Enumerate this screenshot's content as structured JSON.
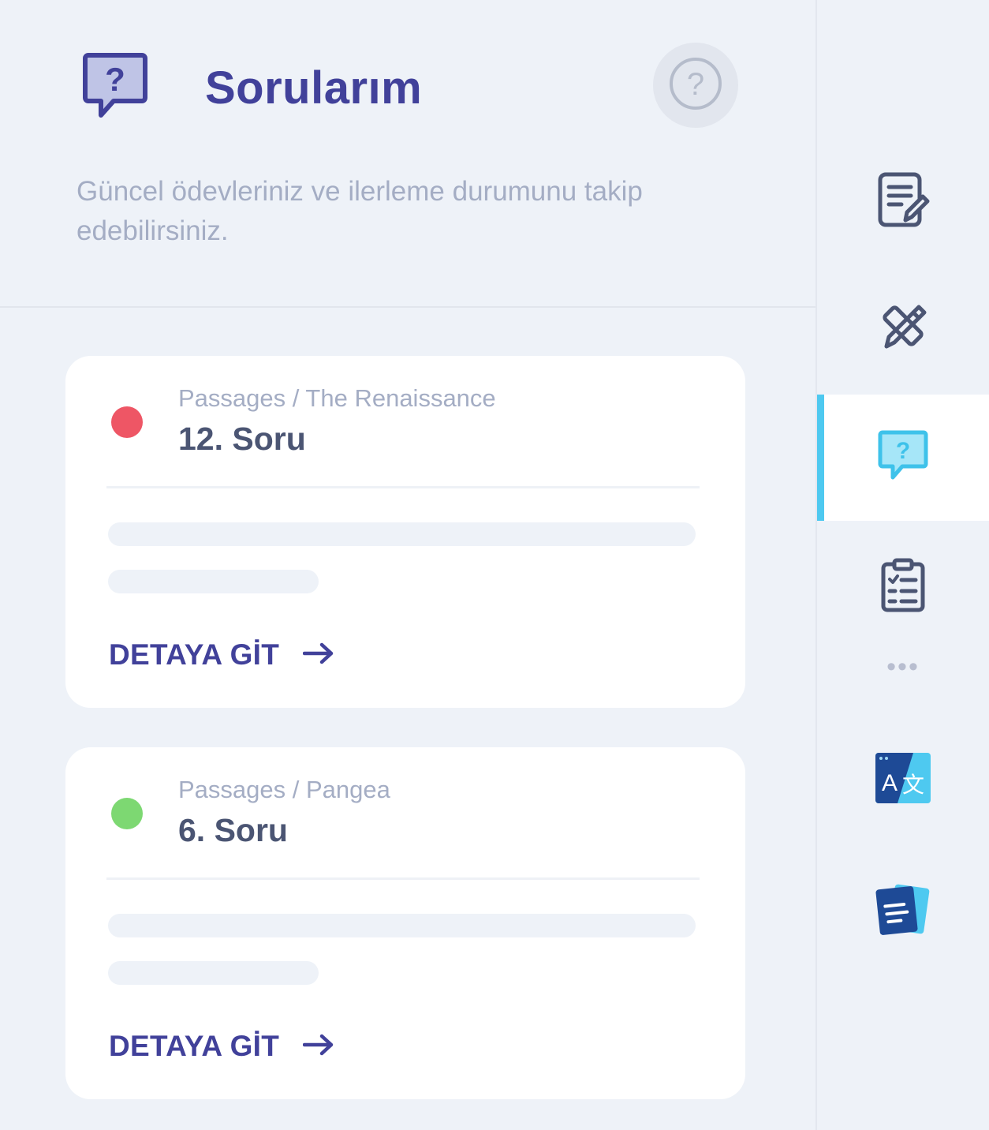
{
  "header": {
    "title": "Sorularım",
    "subtitle": "Güncel ödevleriniz ve ilerleme durumunu takip edebilirsiniz.",
    "header_icon": "question-bubble-icon",
    "help_icon": "help-circle-icon"
  },
  "questions": [
    {
      "breadcrumb": "Passages / The Renaissance",
      "title": "12. Soru",
      "status_color": "#ee5665",
      "link_label": "DETAYA GİT",
      "link_icon": "arrow-right-icon"
    },
    {
      "breadcrumb": "Passages / Pangea",
      "title": "6. Soru",
      "status_color": "#7dd872",
      "link_label": "DETAYA GİT",
      "link_icon": "arrow-right-icon"
    }
  ],
  "sidebar": {
    "items": [
      {
        "icon": "document-edit-icon",
        "active": false
      },
      {
        "icon": "pencil-ruler-icon",
        "active": false
      },
      {
        "icon": "question-bubble-icon",
        "active": true
      },
      {
        "icon": "clipboard-checklist-icon",
        "active": false
      },
      {
        "icon": "more-dots-icon",
        "active": false
      },
      {
        "icon": "translate-icon",
        "active": false
      },
      {
        "icon": "flashcards-icon",
        "active": false
      }
    ]
  },
  "colors": {
    "brand": "#41419a",
    "accent": "#4ec9f0",
    "background": "#eef2f8",
    "muted_text": "#a4adc4",
    "title_text": "#4b5573"
  }
}
